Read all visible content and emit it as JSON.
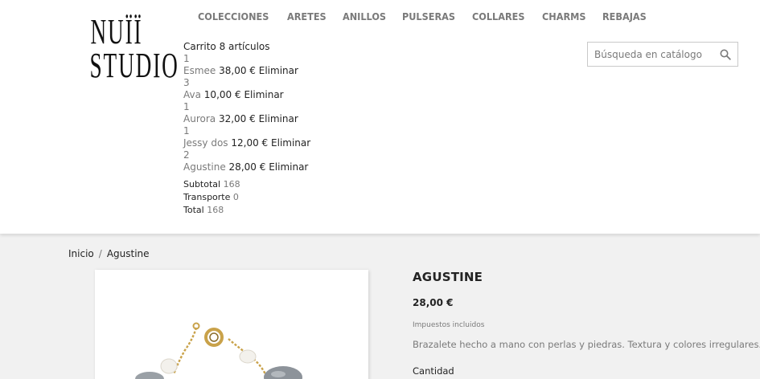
{
  "logo": {
    "line1": "NUÏÏ",
    "line2": "STUDIO"
  },
  "nav": {
    "items": [
      {
        "label": "COLECCIONES"
      },
      {
        "label": "ARETES"
      },
      {
        "label": "ANILLOS"
      },
      {
        "label": "PULSERAS"
      },
      {
        "label": "COLLARES"
      },
      {
        "label": "CHARMS"
      },
      {
        "label": "REBAJAS"
      }
    ]
  },
  "search": {
    "placeholder": "Búsqueda en catálogo",
    "icon": "magnifier"
  },
  "cart": {
    "title": "Carrito 8 artículos",
    "items": [
      {
        "qty": "1",
        "name": "Esmee",
        "price": "38,00 €",
        "remove": "Eliminar"
      },
      {
        "qty": "3",
        "name": "Ava",
        "price": "10,00 €",
        "remove": "Eliminar"
      },
      {
        "qty": "1",
        "name": "Aurora",
        "price": "32,00 €",
        "remove": "Eliminar"
      },
      {
        "qty": "1",
        "name": "Jessy dos",
        "price": "12,00 €",
        "remove": "Eliminar"
      },
      {
        "qty": "2",
        "name": "Agustine",
        "price": "28,00 €",
        "remove": "Eliminar"
      }
    ],
    "subtotal_label": "Subtotal",
    "subtotal_value": "168",
    "shipping_label": "Transporte",
    "shipping_value": "0",
    "total_label": "Total",
    "total_value": "168"
  },
  "breadcrumb": {
    "home": "Inicio",
    "separator": "/",
    "current": "Agustine"
  },
  "product": {
    "title": "AGUSTINE",
    "price": "28,00 €",
    "tax_note": "Impuestos incluidos",
    "description": "Brazalete hecho a mano con perlas y piedras. Textura y colores irregulares.",
    "quantity_label": "Cantidad"
  },
  "colors": {
    "text": "#232323",
    "muted": "#7a7a7a",
    "page_bg": "#f1f1f1",
    "gold": "#c9a24a"
  }
}
